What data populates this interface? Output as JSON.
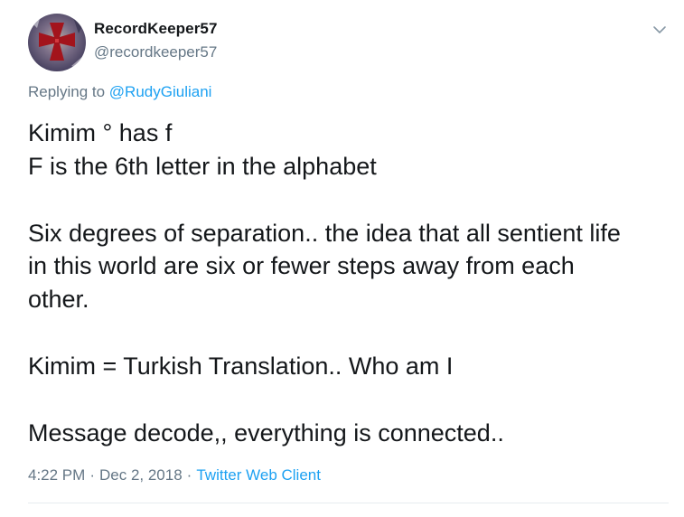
{
  "tweet": {
    "display_name": "RecordKeeper57",
    "handle": "@recordkeeper57",
    "replying_prefix": "Replying to",
    "replying_to": "@RudyGiuliani",
    "lines": [
      "Kimim ° has f",
      "F is the 6th letter in the alphabet",
      "",
      "Six degrees of separation.. the idea that all sentient life",
      "in this world are six or fewer steps away from each",
      "other.",
      "",
      "Kimim = Turkish Translation.. Who am I",
      "",
      "Message decode,, everything is connected.."
    ],
    "time": "4:22 PM",
    "date": "Dec 2, 2018",
    "separator": "·",
    "client": "Twitter Web Client"
  },
  "icons": {
    "avatar": "templar-cross-avatar",
    "menu": "chevron-down-icon"
  },
  "colors": {
    "text": "#14171a",
    "secondary": "#657786",
    "link": "#1da1f2",
    "divider": "#e6ecf0",
    "avatar_cross": "#a3141c",
    "avatar_bg": "#5e5877"
  }
}
